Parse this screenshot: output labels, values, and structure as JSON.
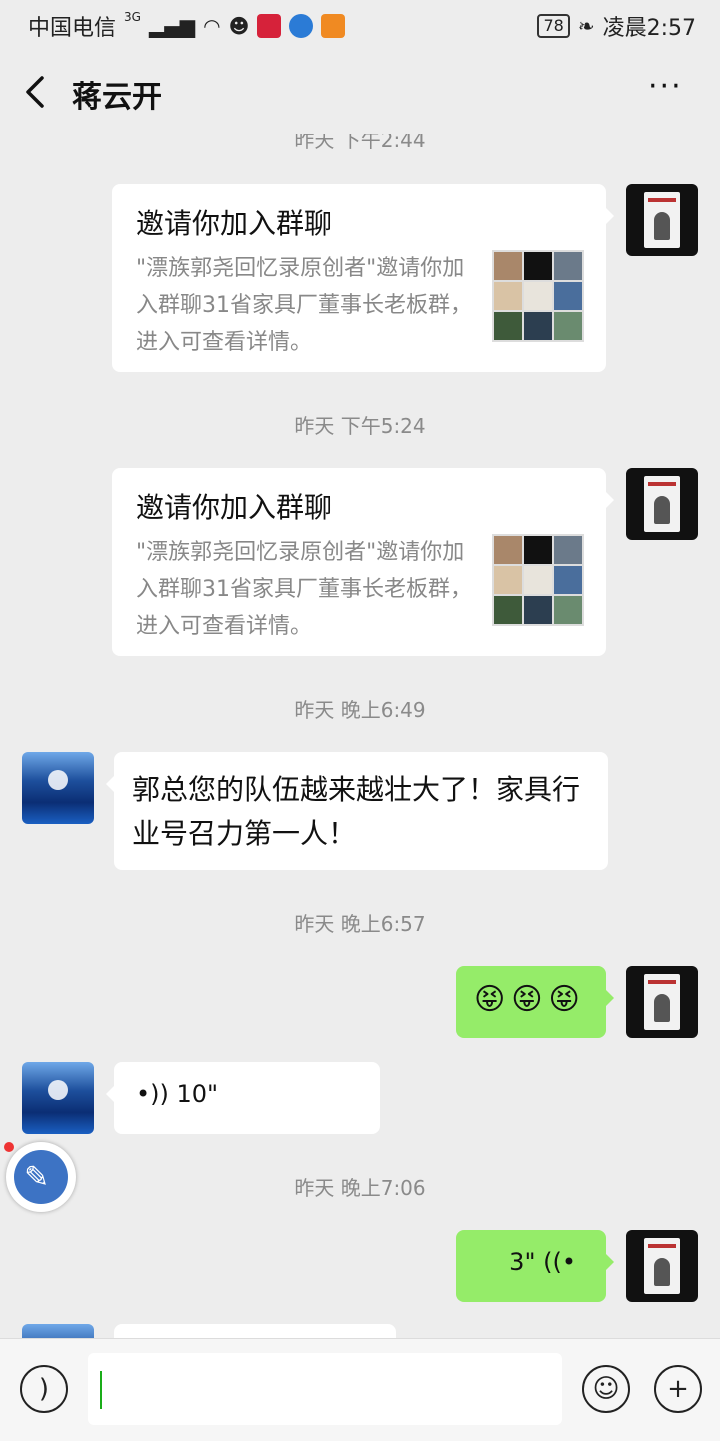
{
  "status_bar": {
    "carrier": "中国电信",
    "network": "3G",
    "battery": "78",
    "time": "凌晨2:57"
  },
  "header": {
    "title": "蒋云开",
    "more_label": "···"
  },
  "timestamps": {
    "t1": "昨天 下午2:44",
    "t2": "昨天 下午5:24",
    "t3": "昨天 晚上6:49",
    "t4": "昨天 晚上6:57",
    "t5": "昨天 晚上7:06"
  },
  "messages": {
    "invite1": {
      "title": "邀请你加入群聊",
      "desc": "\"漂族郭尧回忆录原创者\"邀请你加入群聊31省家具厂董事长老板群，进入可查看详情。"
    },
    "invite2": {
      "title": "邀请你加入群聊",
      "desc": "\"漂族郭尧回忆录原创者\"邀请你加入群聊31省家具厂董事长老板群，进入可查看详情。"
    },
    "text1": "郭总您的队伍越来越壮大了！家具行业号召力第一人！",
    "emoji1": "😝😝😝",
    "voice1": "•)) 10\"",
    "voice2": "3\" ((•"
  },
  "icons": {
    "back": "chevron-left-icon",
    "more": "ellipsis-icon",
    "voice_toggle": "voice-icon",
    "emoji": "smile-icon",
    "add": "plus-icon"
  },
  "input": {
    "value": ""
  },
  "colors": {
    "background": "#ededed",
    "own_bubble": "#95ec69",
    "other_bubble": "#ffffff",
    "caret": "#1aad19"
  }
}
